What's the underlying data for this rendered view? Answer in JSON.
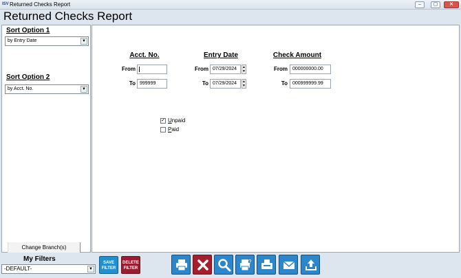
{
  "window": {
    "title": "Returned Checks Report",
    "minimize_icon": "minimize-icon",
    "restore_icon": "restore-icon",
    "close_icon": "close-icon"
  },
  "page": {
    "title": "Returned Checks Report"
  },
  "sort": {
    "option1_label": "Sort Option 1",
    "option1_value": "by Entry Date",
    "option2_label": "Sort Option 2",
    "option2_value": "by Acct. No.",
    "change_branch": "Change Branch(s)"
  },
  "criteria": {
    "acct_header": "Acct. No.",
    "entry_header": "Entry Date",
    "amount_header": "Check Amount",
    "from_label": "From",
    "to_label": "To",
    "acct_from": "",
    "acct_to": "999999",
    "date_from": "07/29/2024",
    "date_to": "07/29/2024",
    "amount_from": "000000000.00",
    "amount_to": "000999999.99"
  },
  "status": {
    "unpaid_first": "U",
    "unpaid_rest": "npaid",
    "unpaid_checked": true,
    "paid_first": "P",
    "paid_rest": "aid",
    "paid_checked": false
  },
  "filters": {
    "label": "My Filters",
    "selected": "-DEFAULT-",
    "save_line1": "SAVE",
    "save_line2": "FILTER",
    "delete_line1": "DELETE",
    "delete_line2": "FILTER"
  },
  "toolbar": [
    {
      "icon": "print-icon"
    },
    {
      "icon": "cancel-icon"
    },
    {
      "icon": "search-icon"
    },
    {
      "icon": "print-preview-icon"
    },
    {
      "icon": "fax-icon"
    },
    {
      "icon": "email-icon"
    },
    {
      "icon": "export-icon"
    }
  ],
  "colors": {
    "accent": "#2c86c9",
    "danger": "#a51e2e",
    "background": "#dde6ee"
  }
}
